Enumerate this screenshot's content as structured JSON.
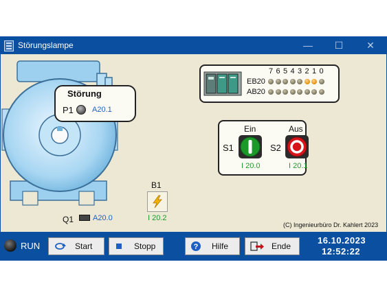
{
  "window": {
    "title": "Störungslampe"
  },
  "motor": {
    "fault_title": "Störung",
    "p1_label": "P1",
    "p1_address": "A20.1",
    "q1_label": "Q1",
    "q1_address": "A20.0"
  },
  "b1": {
    "label": "B1",
    "address": "I 20.2"
  },
  "plc": {
    "bit_labels": [
      "7",
      "6",
      "5",
      "4",
      "3",
      "2",
      "1",
      "0"
    ],
    "eb_label": "EB20",
    "ab_label": "AB20",
    "eb_states": [
      0,
      0,
      0,
      0,
      0,
      1,
      1,
      0
    ],
    "ab_states": [
      0,
      0,
      0,
      0,
      0,
      0,
      0,
      0
    ]
  },
  "switches": {
    "ein_label": "Ein",
    "aus_label": "Aus",
    "s1_label": "S1",
    "s2_label": "S2",
    "s1_address": "I 20.0",
    "s2_address": "I 20.1"
  },
  "copyright": "(C) Ingenieurbüro Dr. Kahlert 2023",
  "toolbar": {
    "run_label": "RUN",
    "start_label": "Start",
    "stop_label": "Stopp",
    "help_label": "Hilfe",
    "end_label": "Ende"
  },
  "datetime": {
    "date": "16.10.2023",
    "time": "12:52:22"
  },
  "colors": {
    "titlebar": "#0a4fa0",
    "panel": "#ece8d3",
    "on_green": "#1b9a2a",
    "off_red": "#d8141b",
    "address_blue": "#1f5fc2",
    "led_on": "#e08a00"
  }
}
